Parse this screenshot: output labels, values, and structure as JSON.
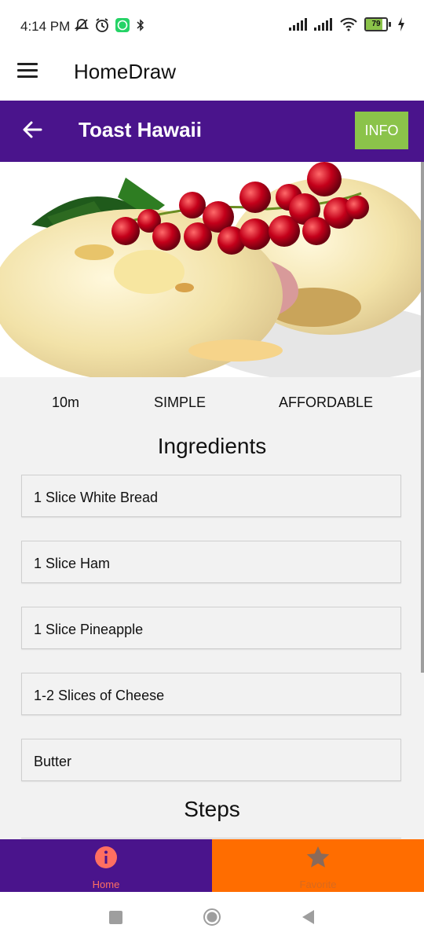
{
  "status_bar": {
    "time": "4:14 PM",
    "battery_level": "79",
    "icons": [
      "mute-icon",
      "alarm-icon",
      "whatsapp-icon",
      "signal-icon",
      "signal-icon",
      "wifi-icon",
      "battery-icon",
      "charging-icon"
    ]
  },
  "app_bar": {
    "title": "HomeDraw"
  },
  "header": {
    "title": "Toast Hawaii",
    "info_label": "INFO",
    "color": "#4a148c",
    "info_color": "#8bc34a"
  },
  "meta": {
    "duration": "10m",
    "complexity": "SIMPLE",
    "affordability": "AFFORDABLE"
  },
  "ingredients": {
    "title": "Ingredients",
    "items": [
      "1 Slice White Bread",
      "1 Slice Ham",
      "1 Slice Pineapple",
      "1-2 Slices of Cheese",
      "Butter"
    ]
  },
  "steps": {
    "title": "Steps"
  },
  "bottom_nav": {
    "home_label": "Home",
    "favorite_label": "Favorite",
    "home_color": "#4a148c",
    "favorite_color": "#ff6d00"
  }
}
